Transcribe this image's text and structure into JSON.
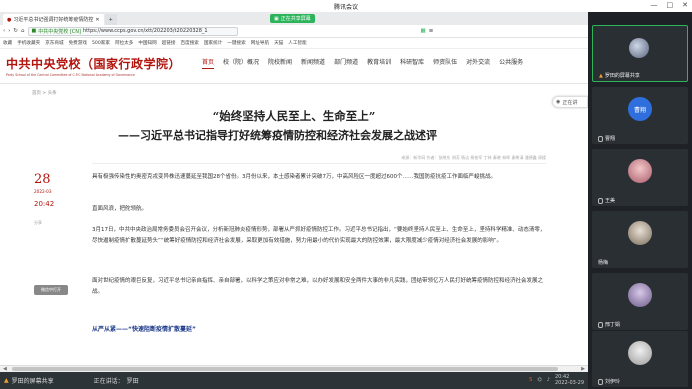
{
  "window": {
    "title": "腾讯会议",
    "controls": [
      "—",
      "□",
      "✕"
    ]
  },
  "browser": {
    "tab_active": "习近平总书记强调打好统筹疫情防控",
    "tab_plus": "+",
    "sharing_label": "正在共享屏幕",
    "url_prefix": "中共中央党校 [CN]",
    "url": "https://www.ccps.gov.cn/xtt/202203/t20220328_1",
    "bookmarks": [
      "收藏",
      "手机收藏夹",
      "京东商城",
      "免费游戏",
      "500家家",
      "阿拉太多",
      "中国知网",
      "超链接",
      "百度搜索",
      "国家统计",
      "一键搜索",
      "网址导航",
      "天猫",
      "人工智能"
    ]
  },
  "site": {
    "logo_main": "中共中央党校（国家行政学院）",
    "logo_sub_en": "Party School of the Central Committee of C.P.C   National Academy of Governance",
    "nav": [
      "首页",
      "校（院）概况",
      "院校新闻",
      "新闻频道",
      "部门频道",
      "教育培训",
      "科研智库",
      "师资队伍",
      "对外交流",
      "公共服务"
    ],
    "float_btn": "正在讲"
  },
  "article": {
    "breadcrumb": "首页 > 头条",
    "title": "“始终坚持人民至上、生命至上”",
    "subtitle": "——习近平总书记指导打好统筹疫情防控和经济社会发展之战述评",
    "meta": "来源：新华网    作者：张晓东  胡芳  杨洁  杨依军  丁林  秦晓  林晖  谢希清  潘德鑫  周楼",
    "day": "28",
    "year_month": "2022-03",
    "time": "20:42",
    "share": "分享",
    "share_box": "微信中打开",
    "paragraphs": [
      "具有极强传染性的奥密克戎变异株迅速蔓延至我国28个省份。3月份以来，本土感染者累计突破7万，中高风险区一度超过600个……我国防疫抗疫工作面临严峻挑战。",
      "直面风浪，把舵领航。",
      "3月17日，中共中央政治局常务委员会召开会议，分析新冠肺炎疫情形势，部署从严抓好疫情防控工作。习近平总书记指出，“要始终坚持人民至上、生命至上，坚持科学精准、动态清零，尽快遏制疫情扩散蔓延势头”“统筹好疫情防控和经济社会发展，采取更加有效措施，努力用最小的代价实现最大的防控效果，最大限度减少疫情对经济社会发展的影响”。",
      "面对世纪疫情的艰巨反复，习近平总书记亲自指挥、亲自部署，以科学之策应对非常之难，以办好发展和安全两件大事的非凡实践，团结带领亿万人民打好统筹疫情防控和经济社会发展之战。"
    ],
    "section_heading": "从严从紧——“快速阻断疫情扩散蔓延”"
  },
  "taskbar": {
    "share_label": "罗田的屏幕共享",
    "speaking": "正在讲话：",
    "speaker": "罗田",
    "clock": "20:42",
    "date": "2022-03-29"
  },
  "participants": [
    {
      "name": "罗田的屏幕共享",
      "avatar_text": ""
    },
    {
      "name": "曹翔",
      "avatar_text": "曹翔"
    },
    {
      "name": "王美",
      "avatar_text": ""
    },
    {
      "name": "杨梅",
      "avatar_text": ""
    },
    {
      "name": "邢丁娟",
      "avatar_text": ""
    },
    {
      "name": "刘伊玲",
      "avatar_text": ""
    }
  ],
  "colors": {
    "brand_red": "#b2140e",
    "share_green": "#2bb45a",
    "meeting_bg": "#1e2226"
  }
}
